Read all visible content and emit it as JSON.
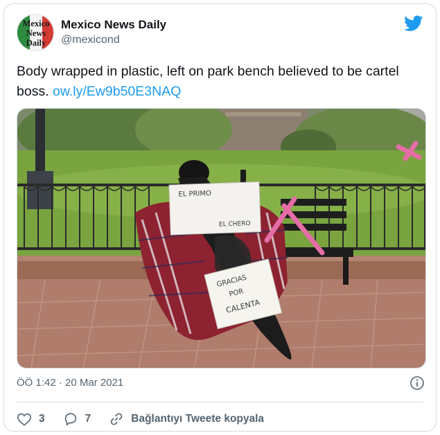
{
  "account": {
    "name": "Mexico News Daily",
    "handle": "@mexicond",
    "avatar_text_lines": [
      "Mexico",
      "News",
      "Daily"
    ]
  },
  "tweet": {
    "text": "Body wrapped in plastic, left on park bench believed to be cartel boss.",
    "link": "ow.ly/Ew9b50E3NAQ",
    "timestamp": "ÖÖ 1:42 · 20 Mar 2021"
  },
  "media": {
    "sign_top": [
      "EL PRIMO",
      "EL CHERO"
    ],
    "sign_bottom": [
      "GRACIAS",
      "POR",
      "CALENTA"
    ]
  },
  "actions": {
    "likes": "3",
    "replies": "7",
    "copy_link_label": "Bağlantıyı Tweete kopyala"
  },
  "icons": {
    "brand": "twitter-bird-icon",
    "info": "info-icon",
    "like": "heart-icon",
    "reply": "reply-icon",
    "copy": "link-icon"
  },
  "colors": {
    "accent": "#1d9bf0",
    "secondary_text": "#536471",
    "border": "#cfd9de"
  }
}
